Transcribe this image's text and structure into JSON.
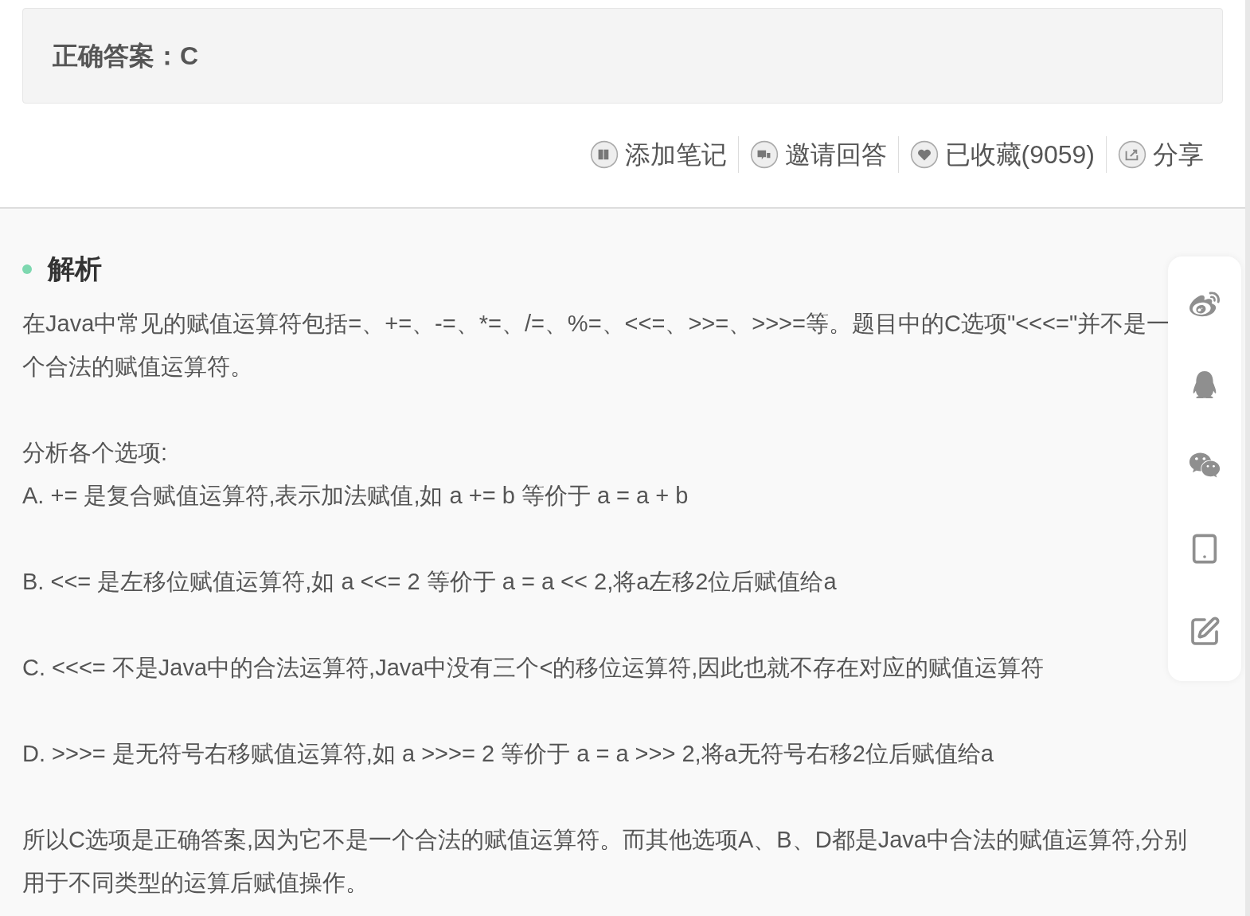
{
  "answer": {
    "label": "正确答案：C"
  },
  "actions": [
    {
      "kind": "note",
      "label": "添加笔记"
    },
    {
      "kind": "invite",
      "label": "邀请回答"
    },
    {
      "kind": "favorite",
      "label": "已收藏(9059)"
    },
    {
      "kind": "share",
      "label": "分享"
    }
  ],
  "analysis": {
    "title": "解析",
    "blocks": [
      [
        "在Java中常见的赋值运算符包括=、+=、-=、*=、/=、%=、<<=、>>=、>>>=等。题目中的C选项\"<<<=\"并不是一个合法的赋值运算符。"
      ],
      [
        "分析各个选项:",
        "A. += 是复合赋值运算符,表示加法赋值,如 a += b 等价于 a = a + b"
      ],
      [
        "B. <<= 是左移位赋值运算符,如 a <<= 2 等价于 a = a << 2,将a左移2位后赋值给a"
      ],
      [
        "C. <<<= 不是Java中的合法运算符,Java中没有三个<的移位运算符,因此也就不存在对应的赋值运算符"
      ],
      [
        "D. >>>= 是无符号右移赋值运算符,如 a >>>= 2 等价于 a = a >>> 2,将a无符号右移2位后赋值给a"
      ],
      [
        "所以C选项是正确答案,因为它不是一个合法的赋值运算符。而其他选项A、B、D都是Java中合法的赋值运算符,分别用于不同类型的运算后赋值操作。"
      ]
    ]
  },
  "share_sidebar": [
    {
      "kind": "weibo"
    },
    {
      "kind": "qq"
    },
    {
      "kind": "wechat"
    },
    {
      "kind": "mobile"
    },
    {
      "kind": "edit"
    }
  ]
}
